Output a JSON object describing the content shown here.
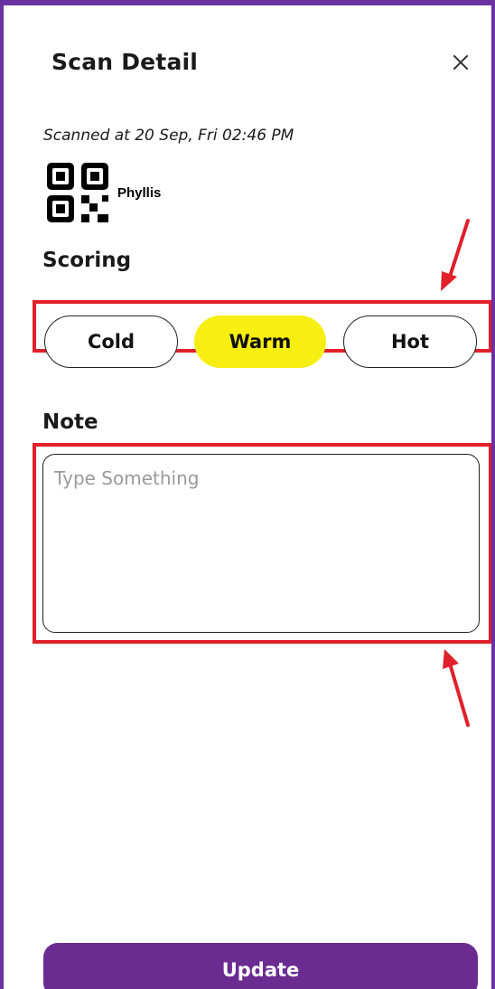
{
  "header": {
    "title": "Scan Detail",
    "close_icon": "close-icon"
  },
  "scan": {
    "scanned_text": "Scanned at 20 Sep, Fri 02:46 PM",
    "qr_icon": "qr-code-icon",
    "contact_name": "Phyllis"
  },
  "scoring": {
    "label": "Scoring",
    "options": [
      "Cold",
      "Warm",
      "Hot"
    ],
    "selected": "Warm"
  },
  "note": {
    "label": "Note",
    "placeholder": "Type Something",
    "value": ""
  },
  "footer": {
    "update_label": "Update"
  },
  "colors": {
    "brand_purple": "#6a2c91",
    "selected_yellow": "#f7ee12",
    "highlight_red": "#e0202a"
  }
}
